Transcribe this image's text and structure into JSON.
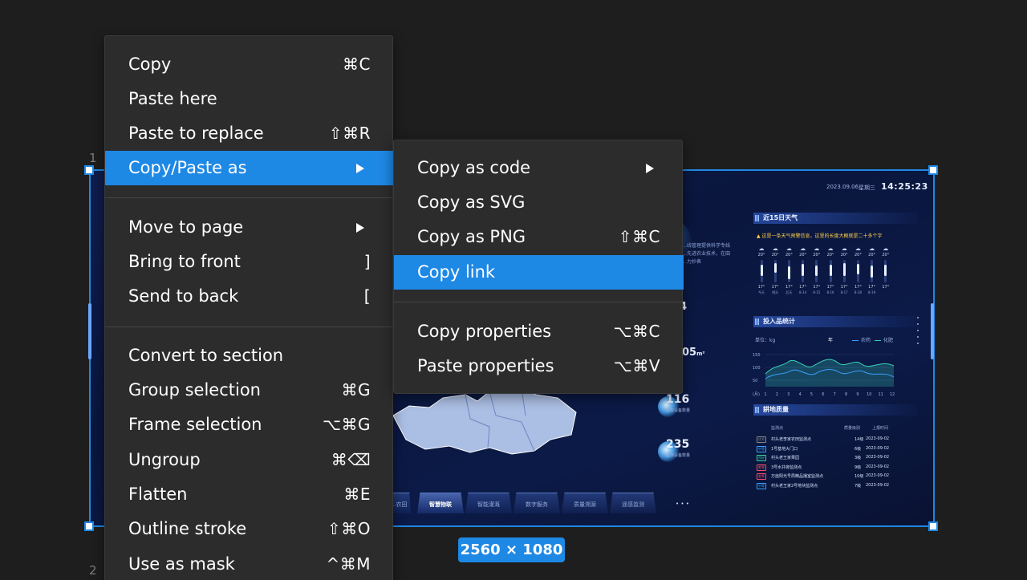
{
  "frame": {
    "label_top": "1",
    "label_bottom": "2",
    "size_badge": "2560 × 1080"
  },
  "dashboard": {
    "date": "2023.09.06",
    "weekday": "星期三",
    "time": "14:25:23",
    "weather_title": "近15日天气",
    "weather_warning": "▲ 这是一条天气预警信息，这里的长度大概就是二十多个字",
    "weather_days": [
      {
        "hi": "20°",
        "lo": "17°",
        "day": "今天"
      },
      {
        "hi": "20°",
        "lo": "17°",
        "day": "明天"
      },
      {
        "hi": "20°",
        "lo": "17°",
        "day": "后天"
      },
      {
        "hi": "20°",
        "lo": "17°",
        "day": "8-14"
      },
      {
        "hi": "20°",
        "lo": "17°",
        "day": "8-15"
      },
      {
        "hi": "20°",
        "lo": "17°",
        "day": "8-16"
      },
      {
        "hi": "20°",
        "lo": "17°",
        "day": "8-17"
      },
      {
        "hi": "20°",
        "lo": "17°",
        "day": "8-18"
      },
      {
        "hi": "20°",
        "lo": "17°",
        "day": "8-19"
      },
      {
        "hi": "20°",
        "lo": "17°",
        "day": ""
      }
    ],
    "input_title": "投入品统计",
    "unit_label": "单位：kg",
    "year_tag": "年",
    "legend_a": "农药",
    "legend_b": "化肥",
    "chart_y_ticks": [
      "150",
      "100",
      "50"
    ],
    "chart_x_label": "(月)",
    "chart_x_ticks": [
      "1",
      "2",
      "3",
      "4",
      "5",
      "6",
      "7",
      "8",
      "9",
      "10",
      "11",
      "12"
    ],
    "quality_title": "耕地质量",
    "table_headers": [
      "监测点",
      "质量级别",
      "上报时间"
    ],
    "table_rows": [
      {
        "tag": "优秀",
        "tag_color": "#8a8a8a",
        "name": "村头老李家农田监测点",
        "level": "14级",
        "date": "2023-09-02"
      },
      {
        "tag": "中等",
        "tag_color": "#3aa0ff",
        "name": "1号基地大门口",
        "level": "6级",
        "date": "2023-09-02"
      },
      {
        "tag": "良好",
        "tag_color": "#3ad39a",
        "name": "村头老王家果园",
        "level": "3级",
        "date": "2023-09-02"
      },
      {
        "tag": "差等",
        "tag_color": "#ff4d6a",
        "name": "3号水井旁监测点",
        "level": "9级",
        "date": "2023-09-02"
      },
      {
        "tag": "差等",
        "tag_color": "#ff4d6a",
        "name": "万亩阳光号局精品播室监测点",
        "level": "10级",
        "date": "2023-09-02"
      },
      {
        "tag": "中等",
        "tag_color": "#3aa0ff",
        "name": "村头老王家2号地块监测点",
        "level": "7级",
        "date": "2023-09-02"
      }
    ],
    "stat_116": "116",
    "stat_116_sub": "智能设备数量",
    "stat_235": "235",
    "stat_235_sub": "监测设备数量",
    "stat_05": "05",
    "stat_05_unit": "m²",
    "stat_4": "4",
    "faint_text": "…线管理提供科学专线\n…先进农业技术，在田\n…力抄表",
    "tabs": [
      "…农田",
      "智慧物联",
      "智能灌溉",
      "数字服务",
      "质量溯源",
      "遥感监测"
    ],
    "tabs_active_index": 1,
    "more_dots": "• • •"
  },
  "menu": {
    "items": [
      {
        "label": "Copy",
        "shortcut": "⌘C"
      },
      {
        "label": "Paste here",
        "shortcut": ""
      },
      {
        "label": "Paste to replace",
        "shortcut": "⇧⌘R"
      },
      {
        "label": "Copy/Paste as",
        "shortcut": "",
        "submenu": true,
        "highlighted": true
      },
      {
        "label": "Move to page",
        "shortcut": "",
        "submenu": true
      },
      {
        "label": "Bring to front",
        "shortcut": "]"
      },
      {
        "label": "Send to back",
        "shortcut": "["
      },
      {
        "label": "Convert to section",
        "shortcut": ""
      },
      {
        "label": "Group selection",
        "shortcut": "⌘G"
      },
      {
        "label": "Frame selection",
        "shortcut": "⌥⌘G"
      },
      {
        "label": "Ungroup",
        "shortcut": "⌘⌫"
      },
      {
        "label": "Flatten",
        "shortcut": "⌘E"
      },
      {
        "label": "Outline stroke",
        "shortcut": "⇧⌘O"
      },
      {
        "label": "Use as mask",
        "shortcut": "^⌘M"
      }
    ]
  },
  "submenu": {
    "items": [
      {
        "label": "Copy as code",
        "shortcut": "",
        "submenu": true
      },
      {
        "label": "Copy as SVG",
        "shortcut": ""
      },
      {
        "label": "Copy as PNG",
        "shortcut": "⇧⌘C"
      },
      {
        "label": "Copy link",
        "shortcut": "",
        "highlighted": true
      },
      {
        "label": "Copy properties",
        "shortcut": "⌥⌘C"
      },
      {
        "label": "Paste properties",
        "shortcut": "⌥⌘V"
      }
    ]
  },
  "colors": {
    "accent": "#1e88e5",
    "menu_bg": "#2c2c2c",
    "canvas_bg": "#1e1e1e"
  }
}
